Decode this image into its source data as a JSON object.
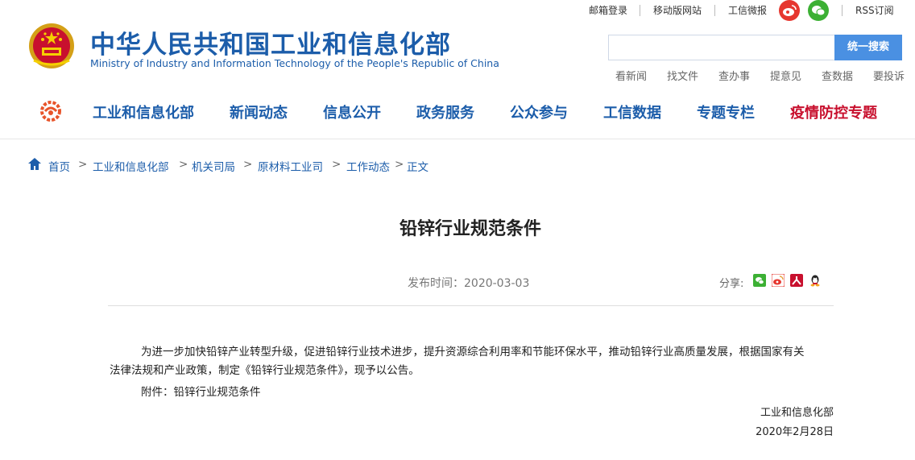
{
  "topbar": {
    "links": [
      "邮箱登录",
      "移动版网站",
      "工信微报",
      "RSS订阅"
    ],
    "social": [
      {
        "icon": "weibo-icon",
        "color": "#e6372f"
      },
      {
        "icon": "wechat-icon",
        "color": "#3cb034"
      }
    ]
  },
  "header": {
    "title": "中华人民共和国工业和信息化部",
    "subtitle": "Ministry of Industry and Information Technology of the People's Republic of China",
    "brand_color": "#1c5daa"
  },
  "search": {
    "placeholder": "",
    "button_label": "统一搜索",
    "quick_links": [
      "看新闻",
      "找文件",
      "查办事",
      "提意见",
      "查数据",
      "要投诉"
    ]
  },
  "nav": {
    "items": [
      "工业和信息化部",
      "新闻动态",
      "信息公开",
      "政务服务",
      "公众参与",
      "工信数据",
      "专题专栏",
      "疫情防控专题"
    ],
    "highlight_color": "#c8102e"
  },
  "breadcrumb": {
    "items": [
      "首页",
      "工业和信息化部",
      "机关司局",
      "原材料工业司",
      "工作动态",
      "正文"
    ],
    "separator": ">"
  },
  "article": {
    "title": "铅锌行业规范条件",
    "publish": "发布时间：2020-03-03",
    "share_label": "分享:",
    "share_icons": [
      "wechat-icon",
      "weibo-icon",
      "people-icon",
      "qq-icon"
    ],
    "paragraph_line1": "为进一步加快铅锌产业转型升级，促进铅锌行业技术进步，提升资源综合利用率和节能环保水平，推动铅锌行业高质量发展，根据国家有关",
    "paragraph_line2": "法律法规和产业政策，制定《铅锌行业规范条件》，现予以公告。",
    "attachment": "附件：铅锌行业规范条件",
    "signature": "工业和信息化部",
    "date": "2020年2月28日"
  }
}
